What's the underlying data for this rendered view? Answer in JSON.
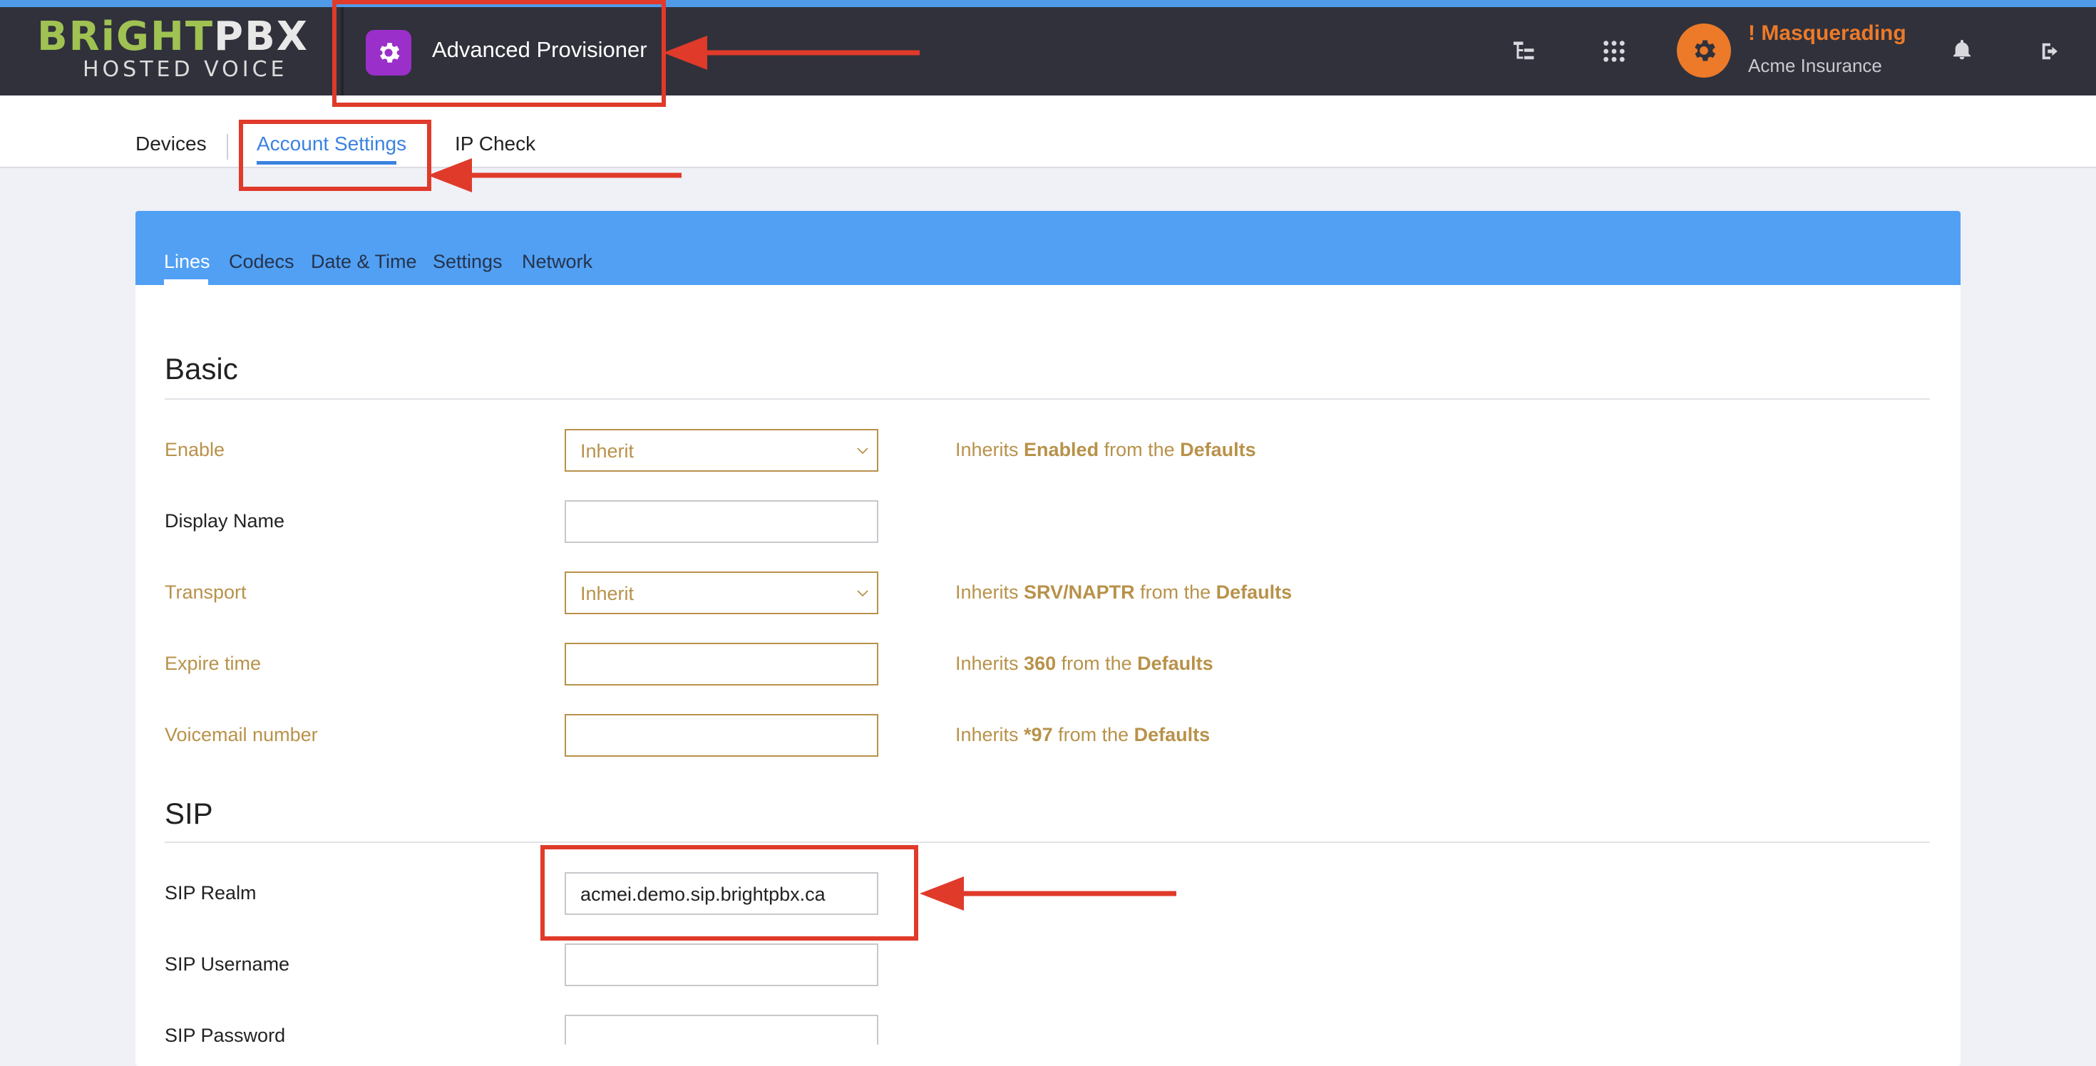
{
  "header": {
    "logo": {
      "brand_bright": "BRiGHT",
      "brand_pbx": "PBX",
      "tagline": "HOSTED VOICE"
    },
    "app_title": "Advanced Provisioner",
    "masquerade": {
      "title": "! Masquerading",
      "account": "Acme Insurance"
    },
    "icons": [
      "tree-icon",
      "apps-grid-icon",
      "gear-icon",
      "bell-icon",
      "logout-icon"
    ]
  },
  "nav": {
    "tabs": [
      {
        "label": "Devices"
      },
      {
        "label": "Account Settings",
        "active": true
      },
      {
        "label": "IP Check"
      }
    ]
  },
  "subtabs": [
    {
      "label": "Lines",
      "active": true
    },
    {
      "label": "Codecs"
    },
    {
      "label": "Date & Time"
    },
    {
      "label": "Settings"
    },
    {
      "label": "Network"
    }
  ],
  "basic": {
    "title": "Basic",
    "enable": {
      "label": "Enable",
      "value": "Inherit",
      "hint_pre": "Inherits ",
      "hint_val": "Enabled",
      "hint_mid": " from the ",
      "hint_src": "Defaults"
    },
    "display_name": {
      "label": "Display Name",
      "value": ""
    },
    "transport": {
      "label": "Transport",
      "value": "Inherit",
      "hint_pre": "Inherits ",
      "hint_val": "SRV/NAPTR",
      "hint_mid": " from the ",
      "hint_src": "Defaults"
    },
    "expire_time": {
      "label": "Expire time",
      "value": "",
      "hint_pre": "Inherits ",
      "hint_val": "360",
      "hint_mid": " from the ",
      "hint_src": "Defaults"
    },
    "voicemail_number": {
      "label": "Voicemail number",
      "value": "",
      "hint_pre": "Inherits ",
      "hint_val": "*97",
      "hint_mid": " from the ",
      "hint_src": "Defaults"
    }
  },
  "sip": {
    "title": "SIP",
    "realm": {
      "label": "SIP Realm",
      "value": "acmei.demo.sip.brightpbx.ca"
    },
    "username": {
      "label": "SIP Username",
      "value": ""
    },
    "password": {
      "label": "SIP Password",
      "value": ""
    }
  },
  "colors": {
    "topbar": "#30313b",
    "accent_blue": "#51a0f4",
    "inherit_gold": "#b8924a",
    "masquerade_orange": "#ec7a29",
    "app_purple": "#9a2fc9",
    "annotation_red": "#e03a2a"
  }
}
